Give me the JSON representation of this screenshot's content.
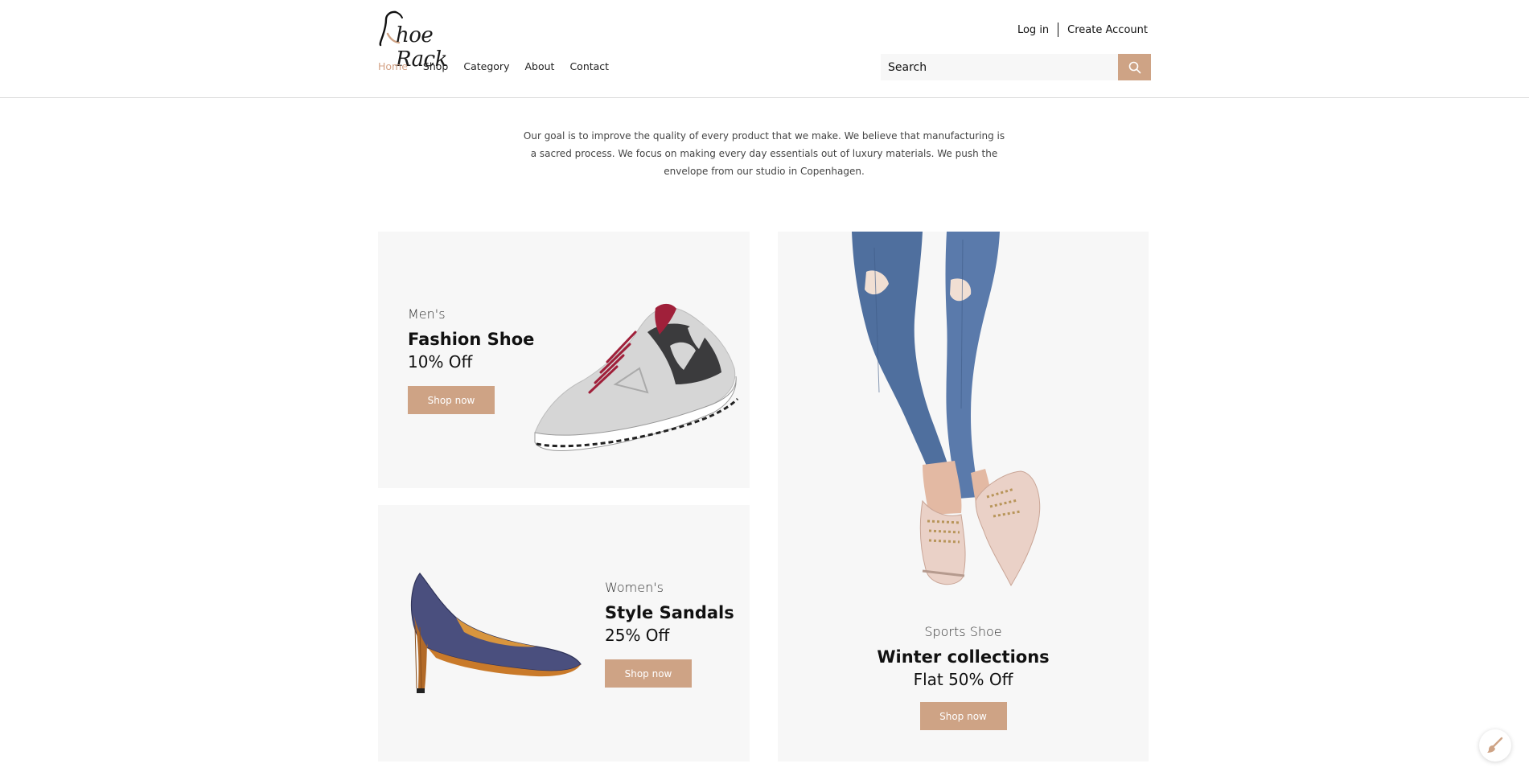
{
  "brand": {
    "logo_text": "hoe Rack",
    "logo_letter": "S",
    "accent_color": "#cea385"
  },
  "account": {
    "login": "Log in",
    "create": "Create Account"
  },
  "nav": {
    "items": [
      {
        "label": "Home",
        "active": true
      },
      {
        "label": "Shop"
      },
      {
        "label": "Category"
      },
      {
        "label": "About"
      },
      {
        "label": "Contact"
      }
    ]
  },
  "search": {
    "placeholder": "Search",
    "icon": "search-icon"
  },
  "intro": {
    "text": "Our goal is to improve the quality of every product that we make. We believe that manufacturing is a sacred process. We focus on making every day essentials out of luxury materials. We push the envelope from our studio in Copenhagen."
  },
  "promos": {
    "mens": {
      "kicker": "Men's",
      "headline": "Fashion Shoe",
      "offer": "10% Off",
      "button": "Shop now"
    },
    "womens": {
      "kicker": "Women's",
      "headline": "Style Sandals",
      "offer": "25% Off",
      "button": "Shop now"
    },
    "sports": {
      "kicker": "Sports Shoe",
      "headline": "Winter collections",
      "offer": "Flat 50% Off",
      "button": "Shop now"
    }
  },
  "floating_button": {
    "icon": "brush-icon"
  }
}
